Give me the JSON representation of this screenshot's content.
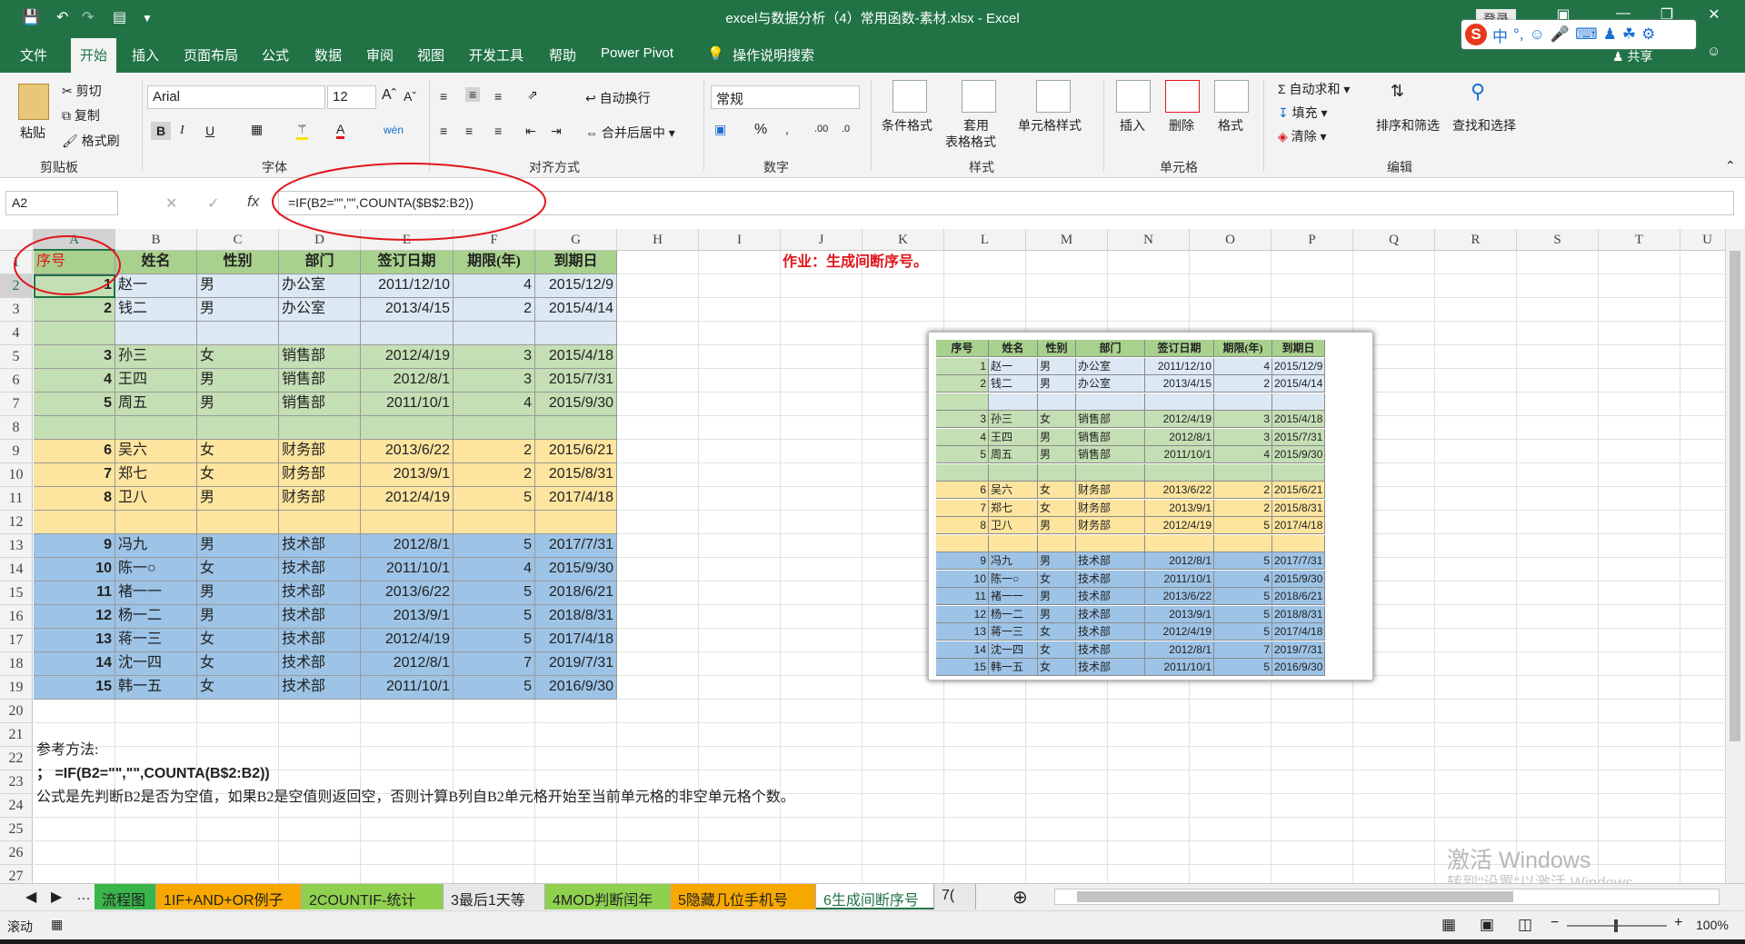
{
  "window": {
    "title": "excel与数据分析（4）常用函数-素材.xlsx - Excel",
    "login": "登录",
    "share": "共享"
  },
  "sogou": {
    "lang": "中"
  },
  "menu": [
    "文件",
    "开始",
    "插入",
    "页面布局",
    "公式",
    "数据",
    "审阅",
    "视图",
    "开发工具",
    "帮助",
    "Power Pivot",
    "操作说明搜索"
  ],
  "ribbon": {
    "clipboard": {
      "label": "剪贴板",
      "paste": "粘贴",
      "cut": "剪切",
      "copy": "复制",
      "format_painter": "格式刷"
    },
    "font": {
      "label": "字体",
      "name": "Arial",
      "size": "12",
      "bold": "B",
      "italic": "I",
      "underline": "U"
    },
    "alignment": {
      "label": "对齐方式",
      "wrap": "自动换行",
      "merge": "合并后居中"
    },
    "number": {
      "label": "数字",
      "format": "常规",
      "percent": "%"
    },
    "styles": {
      "label": "样式",
      "conditional": "条件格式",
      "table1": "套用",
      "table2": "表格格式",
      "cell_style": "单元格样式"
    },
    "cells": {
      "label": "单元格",
      "insert": "插入",
      "delete": "删除",
      "format": "格式"
    },
    "editing": {
      "label": "编辑",
      "autosum": "自动求和",
      "fill": "填充",
      "clear": "清除",
      "sort": "排序和筛选",
      "find": "查找和选择"
    }
  },
  "formula_bar": {
    "name_box": "A2",
    "formula": "=IF(B2=\"\",\"\",COUNTA($B$2:B2))",
    "fx": "fx"
  },
  "columns": [
    "A",
    "B",
    "C",
    "D",
    "E",
    "F",
    "G",
    "H",
    "I",
    "J",
    "K",
    "L",
    "M",
    "N",
    "O",
    "P",
    "Q",
    "R",
    "S",
    "T",
    "U"
  ],
  "rows": [
    "1",
    "2",
    "3",
    "4",
    "5",
    "6",
    "7",
    "8",
    "9",
    "10",
    "11",
    "12",
    "13",
    "14",
    "15",
    "16",
    "17",
    "18",
    "19",
    "20",
    "21",
    "22",
    "23",
    "24",
    "25",
    "26",
    "27"
  ],
  "headers": [
    "序号",
    "姓名",
    "性别",
    "部门",
    "签订日期",
    "期限(年)",
    "到期日"
  ],
  "table": [
    [
      "1",
      "赵一",
      "男",
      "办公室",
      "2011/12/10",
      "4",
      "2015/12/9"
    ],
    [
      "2",
      "钱二",
      "男",
      "办公室",
      "2013/4/15",
      "2",
      "2015/4/14"
    ],
    [
      "",
      "",
      "",
      "",
      "",
      "",
      ""
    ],
    [
      "3",
      "孙三",
      "女",
      "销售部",
      "2012/4/19",
      "3",
      "2015/4/18"
    ],
    [
      "4",
      "王四",
      "男",
      "销售部",
      "2012/8/1",
      "3",
      "2015/7/31"
    ],
    [
      "5",
      "周五",
      "男",
      "销售部",
      "2011/10/1",
      "4",
      "2015/9/30"
    ],
    [
      "",
      "",
      "",
      "",
      "",
      "",
      ""
    ],
    [
      "6",
      "吴六",
      "女",
      "财务部",
      "2013/6/22",
      "2",
      "2015/6/21"
    ],
    [
      "7",
      "郑七",
      "女",
      "财务部",
      "2013/9/1",
      "2",
      "2015/8/31"
    ],
    [
      "8",
      "卫八",
      "男",
      "财务部",
      "2012/4/19",
      "5",
      "2017/4/18"
    ],
    [
      "",
      "",
      "",
      "",
      "",
      "",
      ""
    ],
    [
      "9",
      "冯九",
      "男",
      "技术部",
      "2012/8/1",
      "5",
      "2017/7/31"
    ],
    [
      "10",
      "陈一○",
      "女",
      "技术部",
      "2011/10/1",
      "4",
      "2015/9/30"
    ],
    [
      "11",
      "褚一一",
      "男",
      "技术部",
      "2013/6/22",
      "5",
      "2018/6/21"
    ],
    [
      "12",
      "杨一二",
      "男",
      "技术部",
      "2013/9/1",
      "5",
      "2018/8/31"
    ],
    [
      "13",
      "蒋一三",
      "女",
      "技术部",
      "2012/4/19",
      "5",
      "2017/4/18"
    ],
    [
      "14",
      "沈一四",
      "女",
      "技术部",
      "2012/8/1",
      "7",
      "2019/7/31"
    ],
    [
      "15",
      "韩一五",
      "女",
      "技术部",
      "2011/10/1",
      "5",
      "2016/9/30"
    ]
  ],
  "homework": "作业：生成间断序号。",
  "notes": {
    "r22": "参考方法:",
    "r23": "；  =IF(B2=\"\",\"\",COUNTA(B$2:B2))",
    "r24": "公式是先判断B2是否为空值，如果B2是空值则返回空，否则计算B列自B2单元格开始至当前单元格的非空单元格个数。"
  },
  "picture": {
    "headers": [
      "序号",
      "姓名",
      "性别",
      "部门",
      "签订日期",
      "期限(年)",
      "到期日"
    ],
    "rows": [
      [
        "1",
        "赵一",
        "男",
        "办公室",
        "2011/12/10",
        "4",
        "2015/12/9"
      ],
      [
        "2",
        "钱二",
        "男",
        "办公室",
        "2013/4/15",
        "2",
        "2015/4/14"
      ],
      [
        "",
        "",
        "",
        "",
        "",
        "",
        ""
      ],
      [
        "3",
        "孙三",
        "女",
        "销售部",
        "2012/4/19",
        "3",
        "2015/4/18"
      ],
      [
        "4",
        "王四",
        "男",
        "销售部",
        "2012/8/1",
        "3",
        "2015/7/31"
      ],
      [
        "5",
        "周五",
        "男",
        "销售部",
        "2011/10/1",
        "4",
        "2015/9/30"
      ],
      [
        "",
        "",
        "",
        "",
        "",
        "",
        ""
      ],
      [
        "6",
        "吴六",
        "女",
        "财务部",
        "2013/6/22",
        "2",
        "2015/6/21"
      ],
      [
        "7",
        "郑七",
        "女",
        "财务部",
        "2013/9/1",
        "2",
        "2015/8/31"
      ],
      [
        "8",
        "卫八",
        "男",
        "财务部",
        "2012/4/19",
        "5",
        "2017/4/18"
      ],
      [
        "",
        "",
        "",
        "",
        "",
        "",
        ""
      ],
      [
        "9",
        "冯九",
        "男",
        "技术部",
        "2012/8/1",
        "5",
        "2017/7/31"
      ],
      [
        "10",
        "陈一○",
        "女",
        "技术部",
        "2011/10/1",
        "4",
        "2015/9/30"
      ],
      [
        "11",
        "褚一一",
        "男",
        "技术部",
        "2013/6/22",
        "5",
        "2018/6/21"
      ],
      [
        "12",
        "杨一二",
        "男",
        "技术部",
        "2013/9/1",
        "5",
        "2018/8/31"
      ],
      [
        "13",
        "蒋一三",
        "女",
        "技术部",
        "2012/4/19",
        "5",
        "2017/4/18"
      ],
      [
        "14",
        "沈一四",
        "女",
        "技术部",
        "2012/8/1",
        "7",
        "2019/7/31"
      ],
      [
        "15",
        "韩一五",
        "女",
        "技术部",
        "2011/10/1",
        "5",
        "2016/9/30"
      ]
    ]
  },
  "tabs": [
    "流程图",
    "1IF+AND+OR例子",
    "2COUNTIF-统计",
    "3最后1天等",
    "4MOD判断闰年",
    "5隐藏几位手机号",
    "6生成间断序号",
    "7("
  ],
  "tab_colors": [
    "#39b54a",
    "#f7a800",
    "#8fd14f",
    "#e8e8e8",
    "#8fd14f",
    "#f7a800",
    "#ffffff",
    "#e8e8e8"
  ],
  "status": {
    "mode": "滚动",
    "zoom": "100%"
  },
  "watermark": {
    "line1": "激活 Windows",
    "line2": "转到\"设置\"以激活 Windows。"
  },
  "colors": {
    "green_fill": "#c4dfb4",
    "blue_fill": "#dce9f5",
    "orange_fill": "#fde59f",
    "tech_fill": "#9dc3e6",
    "header_fill": "#a9d18e",
    "excel_green": "#217346",
    "annotation_red": "#e0161c"
  }
}
